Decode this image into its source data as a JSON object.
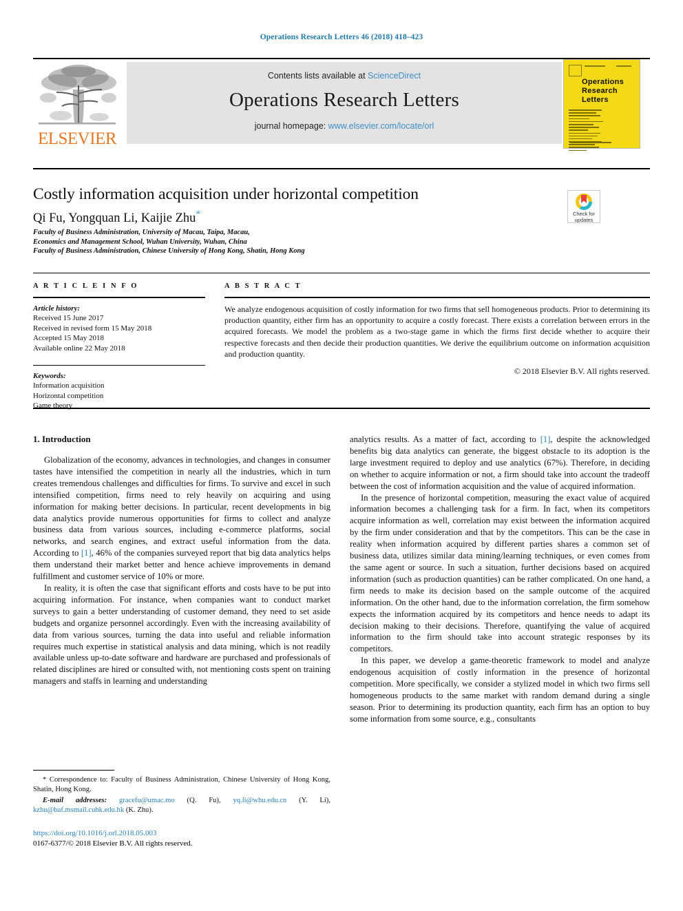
{
  "running_head": "Operations Research Letters 46 (2018) 418–423",
  "masthead": {
    "contents_prefix": "Contents lists available at ",
    "sciencedirect": "ScienceDirect",
    "journal_title": "Operations Research Letters",
    "homepage_prefix": "journal homepage: ",
    "homepage_url": "www.elsevier.com/locate/orl",
    "publisher": "ELSEVIER",
    "logo_icon": "elsevier-tree-logo"
  },
  "cover": {
    "line1": "Operations",
    "line2": "Research",
    "line3": "Letters",
    "color": "#f4d917"
  },
  "crossmark": {
    "label_line1": "Check for",
    "label_line2": "updates",
    "icon": "crossmark-icon"
  },
  "article": {
    "title": "Costly information acquisition under horizontal competition",
    "authors": "Qi Fu, Yongquan Li, Kaijie Zhu",
    "corresponding_marker": "*",
    "affiliations": [
      "Faculty of Business Administration, University of Macau, Taipa, Macau,",
      "Economics and Management School, Wuhan University, Wuhan, China",
      "Faculty of Business Administration, Chinese University of Hong Kong, Shatin, Hong Kong"
    ]
  },
  "article_info": {
    "heading": "A R T I C L E   I N F O",
    "history_label": "Article history:",
    "history": [
      "Received 15 June 2017",
      "Received in revised form 15 May 2018",
      "Accepted 15 May 2018",
      "Available online 22 May 2018"
    ],
    "keywords_label": "Keywords:",
    "keywords": [
      "Information acquisition",
      "Horizontal competition",
      "Game theory"
    ]
  },
  "abstract": {
    "heading": "A B S T R A C T",
    "text": "We analyze endogenous acquisition of costly information for two firms that sell homogeneous products. Prior to determining its production quantity, either firm has an opportunity to acquire a costly forecast. There exists a correlation between errors in the acquired forecasts. We model the problem as a two-stage game in which the firms first decide whether to acquire their respective forecasts and then decide their production quantities. We derive the equilibrium outcome on information acquisition and production quantity.",
    "copyright": "© 2018 Elsevier B.V. All rights reserved."
  },
  "body": {
    "section_heading": "1. Introduction",
    "left_paragraphs": [
      "Globalization of the economy, advances in technologies, and changes in consumer tastes have intensified the competition in nearly all the industries, which in turn creates tremendous challenges and difficulties for firms. To survive and excel in such intensified competition, firms need to rely heavily on acquiring and using information for making better decisions. In particular, recent developments in big data analytics provide numerous opportunities for firms to collect and analyze business data from various sources, including e-commerce platforms, social networks, and search engines, and extract useful information from the data. According to [1], 46% of the companies surveyed report that big data analytics helps them understand their market better and hence achieve improvements in demand fulfillment and customer service of 10% or more.",
      "In reality, it is often the case that significant efforts and costs have to be put into acquiring information. For instance, when companies want to conduct market surveys to gain a better understanding of customer demand, they need to set aside budgets and organize personnel accordingly. Even with the increasing availability of data from various sources, turning the data into useful and reliable information requires much expertise in statistical analysis and data mining, which is not readily available unless up-to-date software and hardware are purchased and professionals of related disciplines are hired or consulted with, not mentioning costs spent on training managers and staffs in learning and understanding"
    ],
    "right_paragraphs": [
      "analytics results. As a matter of fact, according to [1], despite the acknowledged benefits big data analytics can generate, the biggest obstacle to its adoption is the large investment required to deploy and use analytics (67%). Therefore, in deciding on whether to acquire information or not, a firm should take into account the tradeoff between the cost of information acquisition and the value of acquired information.",
      "In the presence of horizontal competition, measuring the exact value of acquired information becomes a challenging task for a firm. In fact, when its competitors acquire information as well, correlation may exist between the information acquired by the firm under consideration and that by the competitors. This can be the case in reality when information acquired by different parties shares a common set of business data, utilizes similar data mining/learning techniques, or even comes from the same agent or source. In such a situation, further decisions based on acquired information (such as production quantities) can be rather complicated. On one hand, a firm needs to make its decision based on the sample outcome of the acquired information. On the other hand, due to the information correlation, the firm somehow expects the information acquired by its competitors and hence needs to adapt its decision making to their decisions. Therefore, quantifying the value of acquired information to the firm should take into account strategic responses by its competitors.",
      "In this paper, we develop a game-theoretic framework to model and analyze endogenous acquisition of costly information in the presence of horizontal competition. More specifically, we consider a stylized model in which two firms sell homogeneous products to the same market with random demand during a single season. Prior to determining its production quantity, each firm has an option to buy some information from some source, e.g., consultants"
    ]
  },
  "footnotes": {
    "correspondence_marker": "*",
    "correspondence": "Correspondence to: Faculty of Business Administration, Chinese University of Hong Kong, Shatin, Hong Kong.",
    "email_label": "E-mail addresses:",
    "emails": [
      {
        "address": "gracefu@umac.mo",
        "owner": "(Q. Fu)"
      },
      {
        "address": "yq.li@whu.edu.cn",
        "owner": "(Y. Li)"
      },
      {
        "address": "kzhu@baf.msmail.cuhk.edu.hk",
        "owner": "(K. Zhu)"
      }
    ],
    "doi": "https://doi.org/10.1016/j.orl.2018.05.003",
    "issn_line": "0167-6377/© 2018 Elsevier B.V. All rights reserved."
  }
}
